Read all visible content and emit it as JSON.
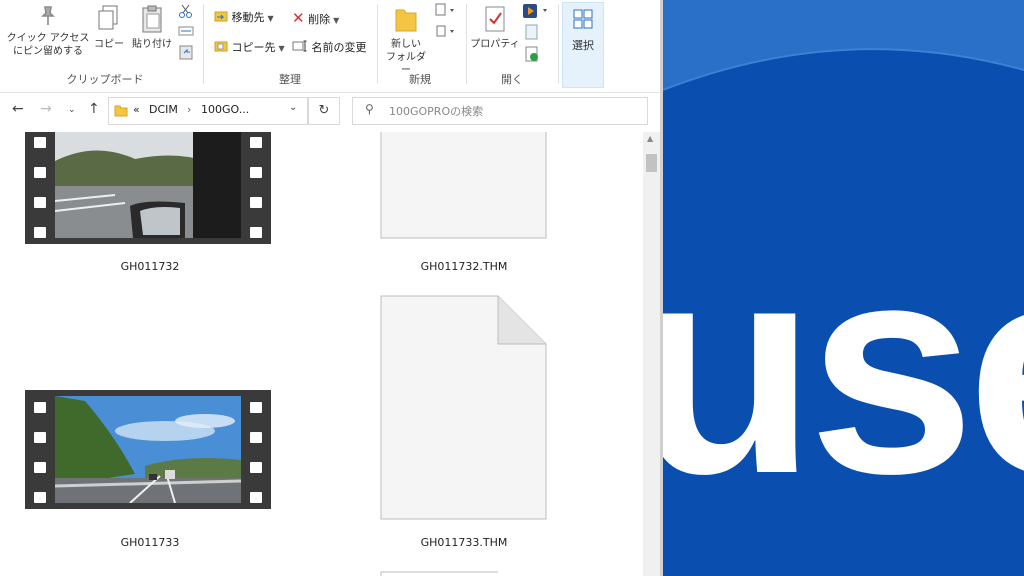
{
  "ribbon": {
    "pin_label_1": "クイック アクセス",
    "pin_label_2": "にピン留めする",
    "copy_label": "コピー",
    "paste_label": "貼り付け",
    "move_to_label": "移動先",
    "copy_to_label": "コピー先",
    "delete_label": "削除",
    "rename_label": "名前の変更",
    "new_folder_label_1": "新しい",
    "new_folder_label_2": "フォルダー",
    "properties_label": "プロパティ",
    "select_label": "選択",
    "groups": {
      "clipboard": "クリップボード",
      "organize": "整理",
      "new": "新規",
      "open": "開く"
    }
  },
  "address": {
    "overflow": "«",
    "crumb_1": "DCIM",
    "sep": "›",
    "crumb_2": "100GO..."
  },
  "search": {
    "placeholder": "100GOPROの検索"
  },
  "files": [
    {
      "name": "GH011732",
      "type": "video"
    },
    {
      "name": "GH011732.THM",
      "type": "document"
    },
    {
      "name": "GH011733",
      "type": "video"
    },
    {
      "name": "GH011733.THM",
      "type": "document"
    }
  ],
  "background_app": {
    "visible_text": "useF"
  },
  "colors": {
    "accent": "#0a4fb0",
    "ribbon_selected": "#e5f1fb",
    "delete_red": "#d13438",
    "folder_yellow": "#f4c542"
  },
  "icons": [
    "pin-icon",
    "copy-icon",
    "paste-icon",
    "cut-icon",
    "move-to-icon",
    "copy-to-icon",
    "delete-icon",
    "rename-icon",
    "folder-icon",
    "properties-icon",
    "select-icon",
    "search-icon",
    "refresh-icon",
    "back-icon",
    "forward-icon",
    "up-icon"
  ]
}
